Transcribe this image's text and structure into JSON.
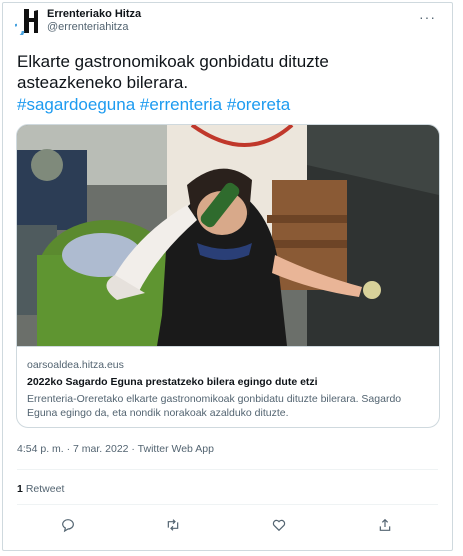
{
  "account": {
    "display_name": "Errenteriako Hitza",
    "handle": "@errenteriahitza",
    "more_icon": "ellipsis-icon",
    "avatar_colors": {
      "mark": "#101010",
      "accent": "#4aa3df"
    }
  },
  "tweet": {
    "text": "Elkarte gastronomikoak gonbidatu dituzte asteazkeneko bilerara.",
    "hashtags": [
      "#sagardoeguna",
      "#errenteria",
      "#orereta"
    ]
  },
  "card": {
    "domain": "oarsoaldea.hitza.eus",
    "title": "2022ko Sagardo Eguna prestatzeko bilera egingo dute etzi",
    "description": "Errenteria-Oreretako elkarte gastronomikoak gonbidatu dituzte bilerara. Sagardo Eguna egingo da, eta nondik norakoak azalduko dituzte.",
    "image_alt": "cider-pouring-photo"
  },
  "meta": {
    "time": "4:54 p. m.",
    "dot": "·",
    "date": "7 mar. 2022",
    "source": "Twitter Web App"
  },
  "stats": {
    "retweet_count": "1",
    "retweet_label": "Retweet"
  },
  "actions": [
    "reply-icon",
    "retweet-icon",
    "like-icon",
    "share-icon"
  ],
  "colors": {
    "link": "#1d9bf0",
    "secondary": "#536471",
    "border": "#cfd9de"
  }
}
